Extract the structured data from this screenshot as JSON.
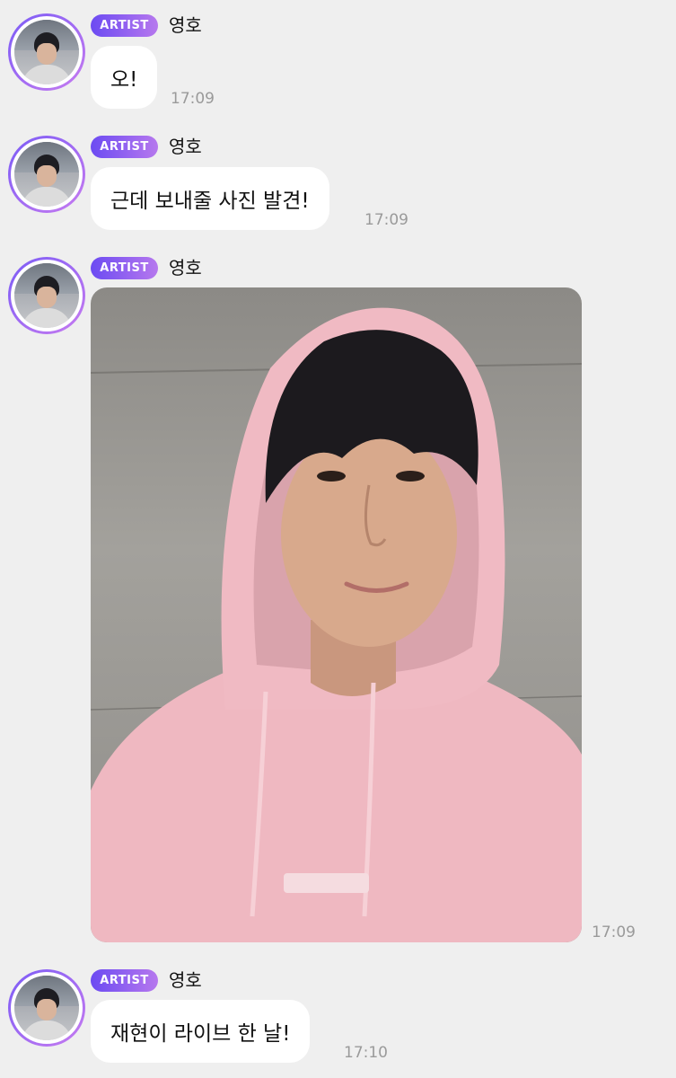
{
  "messages": [
    {
      "badge": "ARTIST",
      "sender": "영호",
      "text": "오!",
      "time": "17:09"
    },
    {
      "badge": "ARTIST",
      "sender": "영호",
      "text": "근데 보내줄 사진 발견!",
      "time": "17:09"
    },
    {
      "badge": "ARTIST",
      "sender": "영호",
      "type": "image",
      "time": "17:09"
    },
    {
      "badge": "ARTIST",
      "sender": "영호",
      "text": "재현이 라이브 한 날!",
      "time": "17:10"
    }
  ],
  "colors": {
    "background": "#efefef",
    "bubble": "#ffffff",
    "badge_start": "#6c4bf2",
    "badge_end": "#b678ee",
    "timestamp": "#9a9a9a"
  }
}
